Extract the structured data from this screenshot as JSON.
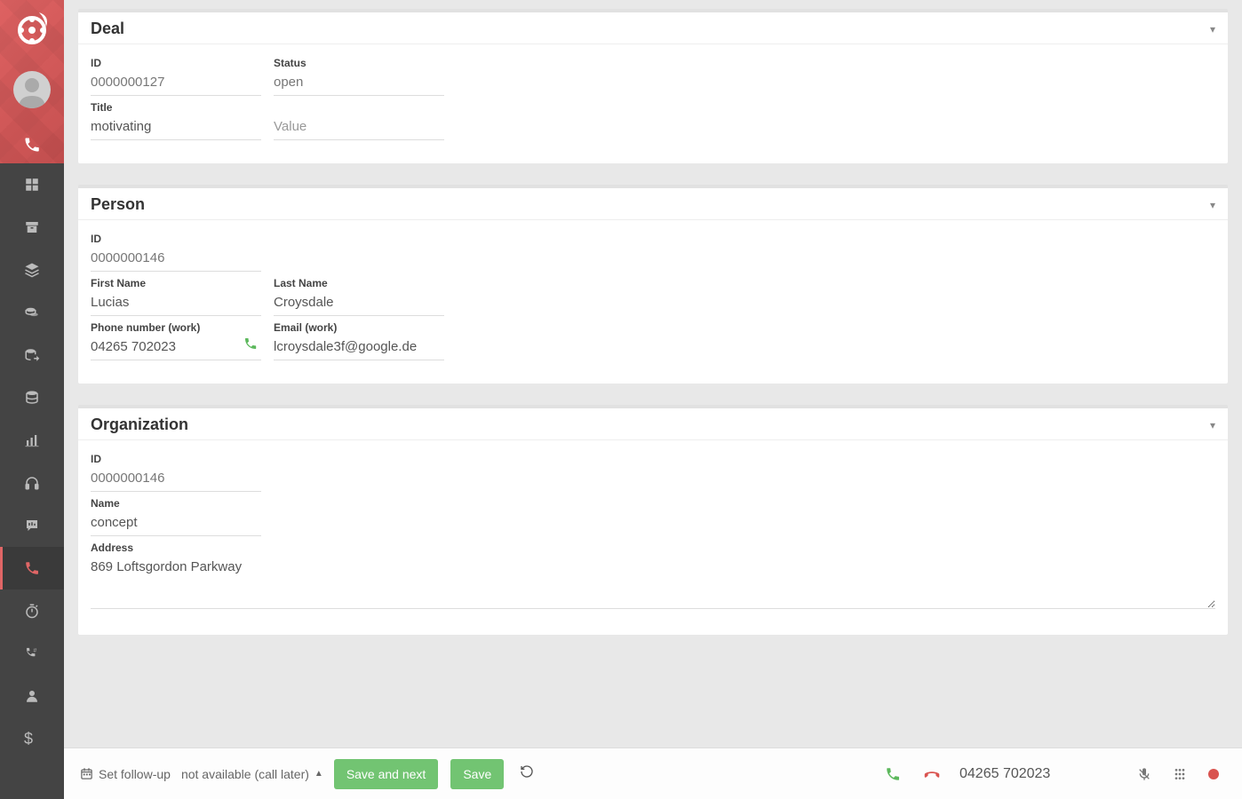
{
  "sidebar": {
    "nav_items": [
      {
        "name": "dashboard"
      },
      {
        "name": "archive"
      },
      {
        "name": "stacks"
      },
      {
        "name": "coins"
      },
      {
        "name": "db-export"
      },
      {
        "name": "database"
      },
      {
        "name": "bar-chart"
      },
      {
        "name": "headphones"
      },
      {
        "name": "chat"
      },
      {
        "name": "phone",
        "active": true
      },
      {
        "name": "stopwatch"
      },
      {
        "name": "phone-hash"
      },
      {
        "name": "user"
      },
      {
        "name": "dollar"
      }
    ]
  },
  "deal": {
    "title": "Deal",
    "id_label": "ID",
    "id_value": "0000000127",
    "status_label": "Status",
    "status_value": "open",
    "title_label": "Title",
    "title_value": "motivating",
    "value_placeholder": "Value"
  },
  "person": {
    "title": "Person",
    "id_label": "ID",
    "id_value": "0000000146",
    "first_name_label": "First Name",
    "first_name_value": "Lucias",
    "last_name_label": "Last Name",
    "last_name_value": "Croysdale",
    "phone_label": "Phone number (work)",
    "phone_value": "04265 702023",
    "email_label": "Email (work)",
    "email_value": "lcroysdale3f@google.de"
  },
  "organization": {
    "title": "Organization",
    "id_label": "ID",
    "id_value": "0000000146",
    "name_label": "Name",
    "name_value": "concept",
    "address_label": "Address",
    "address_value": "869 Loftsgordon Parkway"
  },
  "footer": {
    "followup_label": "Set follow-up",
    "dropdown_value": "not available (call later)",
    "save_next_label": "Save and next",
    "save_label": "Save",
    "phone_number": "04265 702023"
  }
}
